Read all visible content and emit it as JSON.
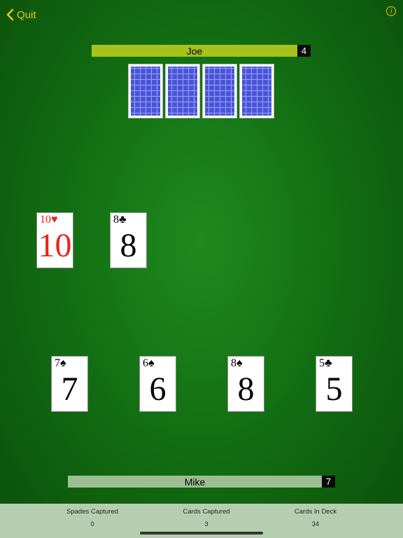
{
  "header": {
    "quit_label": "Quit",
    "info_icon": "info-icon"
  },
  "opponent": {
    "name": "Joe",
    "score": "4",
    "hand_count": 4
  },
  "table_cards": [
    {
      "rank": "10",
      "suit": "♥",
      "color": "red"
    },
    {
      "rank": "8",
      "suit": "♣",
      "color": "black"
    }
  ],
  "player_hand": [
    {
      "rank": "7",
      "suit": "♠",
      "color": "black"
    },
    {
      "rank": "6",
      "suit": "♠",
      "color": "black"
    },
    {
      "rank": "8",
      "suit": "♠",
      "color": "black"
    },
    {
      "rank": "5",
      "suit": "♣",
      "color": "black"
    }
  ],
  "player": {
    "name": "Mike",
    "score": "7"
  },
  "stats": [
    {
      "label": "Spades Captured",
      "value": "0"
    },
    {
      "label": "Cards Captured",
      "value": "3"
    },
    {
      "label": "Cards In Deck",
      "value": "34"
    }
  ],
  "colors": {
    "accent": "#f0c419",
    "felt": "#137013",
    "red_suit": "#e8261a",
    "opponent_bar": "#a5c31b",
    "player_bar": "#9cbe93"
  }
}
